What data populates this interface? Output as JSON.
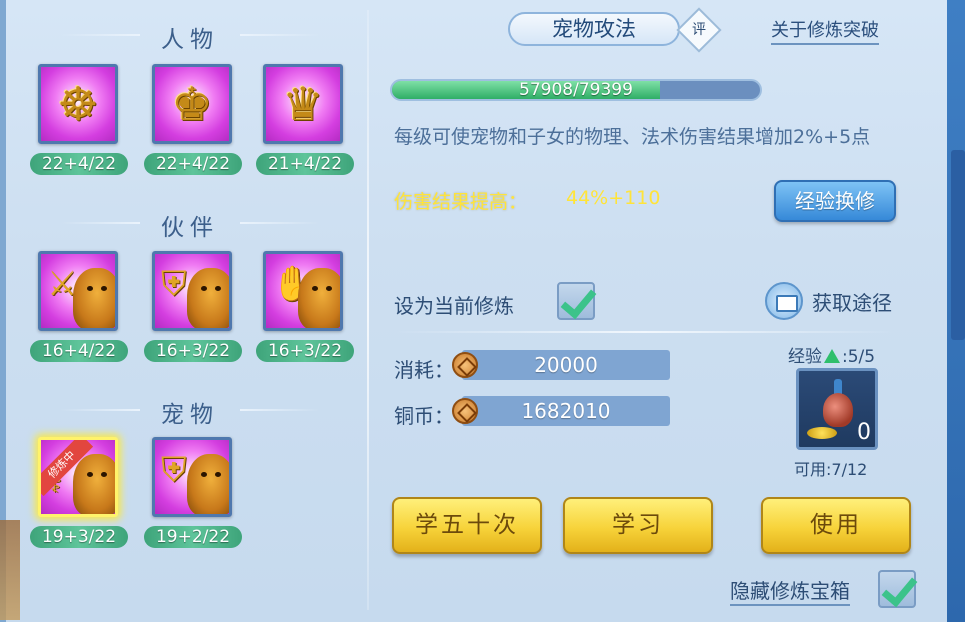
{
  "left": {
    "sections": [
      {
        "title": "人物",
        "skills": [
          {
            "level": "22+4/22",
            "icon": "meditating-figure-icon"
          },
          {
            "level": "22+4/22",
            "icon": "armored-warrior-icon"
          },
          {
            "level": "21+4/22",
            "icon": "robed-warrior-icon"
          }
        ]
      },
      {
        "title": "伙伴",
        "skills": [
          {
            "level": "16+4/22",
            "icon": "lion-sword-icon"
          },
          {
            "level": "16+3/22",
            "icon": "lion-shield-icon"
          },
          {
            "level": "16+3/22",
            "icon": "lion-claw-icon"
          }
        ]
      },
      {
        "title": "宠物",
        "skills": [
          {
            "level": "19+3/22",
            "icon": "cat-staff-icon",
            "badge": "修炼中"
          },
          {
            "level": "19+2/22",
            "icon": "cat-shield-icon"
          }
        ]
      }
    ]
  },
  "right": {
    "title": "宠物攻法",
    "rate_badge": "评",
    "breakthrough_link": "关于修炼突破",
    "progress": {
      "text": "57908/79399",
      "value": 57908,
      "max": 79399
    },
    "description": "每级可使宠物和子女的物理、法术伤害结果增加2%+5点",
    "effect_label": "伤害结果提高：",
    "effect_value": "44%+110",
    "exchange_button": "经验换修",
    "set_current_label": "设为当前修炼",
    "set_current_checked": true,
    "obtain_label": "获取途径",
    "cost_label": "消耗：",
    "cost_value": "20000",
    "coin_label": "铜币：",
    "coin_value": "1682010",
    "exp_label": "经验",
    "exp_value": ":5/5",
    "item_count": "0",
    "usable_text": "可用:7/12",
    "buttons": {
      "learn_fifty": "学五十次",
      "learn": "学习",
      "use": "使用"
    },
    "hide_label": "隐藏修炼宝箱",
    "hide_checked": true
  },
  "colors": {
    "accent_green": "#3ec38a",
    "effect_yellow": "#ffe43a",
    "text_blue": "#4c6f99",
    "skill_bg": "#d43ee0"
  }
}
